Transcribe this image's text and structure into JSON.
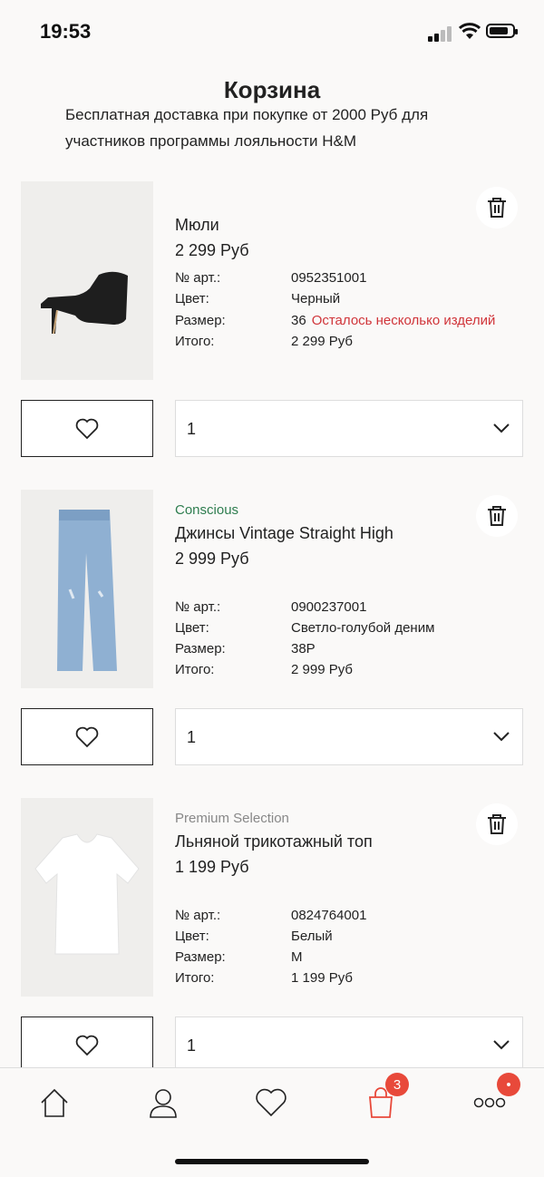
{
  "status": {
    "time": "19:53"
  },
  "page": {
    "title": "Корзина"
  },
  "promo": {
    "line1": "Бесплатная доставка при покупке от 2000 Руб для",
    "line2": "участников программы лояльности H&M"
  },
  "labels": {
    "article": "№ арт.:",
    "color": "Цвет:",
    "size": "Размер:",
    "total": "Итого:"
  },
  "items": [
    {
      "tag": "",
      "name": "Мюли",
      "price": "2 299 Руб",
      "article": "0952351001",
      "color": "Черный",
      "size": "36",
      "stock_warning": "Осталось несколько изделий",
      "total": "2 299 Руб",
      "quantity": "1"
    },
    {
      "tag": "Conscious",
      "tag_color": "#2e7d4f",
      "name": "Джинсы Vintage Straight High",
      "price": "2 999 Руб",
      "article": "0900237001",
      "color": "Светло-голубой деним",
      "size": "38P",
      "stock_warning": "",
      "total": "2 999 Руб",
      "quantity": "1"
    },
    {
      "tag": "Premium Selection",
      "tag_color": "#888888",
      "name": "Льняной трикотажный топ",
      "price": "1 199 Руб",
      "article": "0824764001",
      "color": "Белый",
      "size": "M",
      "stock_warning": "",
      "total": "1 199 Руб",
      "quantity": "1"
    }
  ],
  "tabbar": {
    "cart_badge": "3",
    "more_badge": "•",
    "icons": [
      "home-icon",
      "account-icon",
      "favorites-icon",
      "cart-icon",
      "more-icon"
    ]
  },
  "colors": {
    "accent": "#e8493a",
    "warning": "#d0353a"
  }
}
